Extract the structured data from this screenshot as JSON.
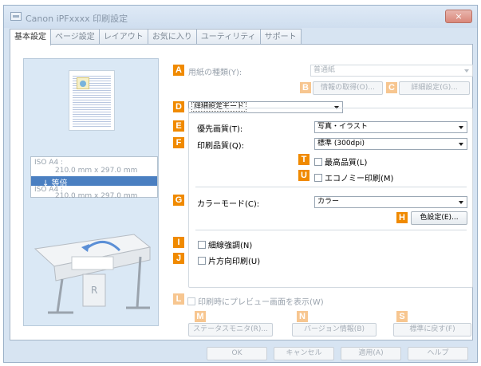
{
  "window": {
    "title": "Canon iPFxxxx 印刷設定",
    "close": "×"
  },
  "tabs": [
    "基本設定",
    "ページ設定",
    "レイアウト",
    "お気に入り",
    "ユーティリティ",
    "サポート"
  ],
  "preview": {
    "size_line1": "ISO A4 :",
    "size_line1_dims": "210.0 mm x 297.0 mm",
    "scale": "↓ 等倍",
    "size_line2": "ISO A4 :",
    "size_line2_dims": "210.0 mm x 297.0 mm"
  },
  "markers": {
    "A": "A",
    "B": "B",
    "C": "C",
    "D": "D",
    "E": "E",
    "F": "F",
    "T": "T",
    "U": "U",
    "G": "G",
    "H": "H",
    "I": "I",
    "J": "J",
    "L": "L",
    "M": "M",
    "N": "N",
    "S": "S"
  },
  "media": {
    "label": "用紙の種類(Y):",
    "value": "普通紙",
    "get_info": "情報の取得(O)...",
    "details": "詳細設定(G)..."
  },
  "mode": {
    "value": "詳細設定モード"
  },
  "quality": {
    "label": "優先画質(T):",
    "value": "写真・イラスト"
  },
  "print_quality": {
    "label": "印刷品質(Q):",
    "value": "標準 (300dpi)"
  },
  "highest": {
    "label": "最高品質(L)"
  },
  "economy": {
    "label": "エコノミー印刷(M)"
  },
  "color_mode": {
    "label": "カラーモード(C):",
    "value": "カラー",
    "settings": "色設定(E)..."
  },
  "thin_lines": {
    "label": "細線強調(N)"
  },
  "unidirectional": {
    "label": "片方向印刷(U)"
  },
  "preview_before": {
    "label": "印刷時にプレビュー画面を表示(W)"
  },
  "footer_buttons": {
    "status": "ステータスモニタ(R)...",
    "version": "バージョン情報(B)",
    "defaults": "標準に戻す(F)"
  },
  "dialog_buttons": {
    "ok": "OK",
    "cancel": "キャンセル",
    "apply": "適用(A)",
    "help": "ヘルプ"
  }
}
